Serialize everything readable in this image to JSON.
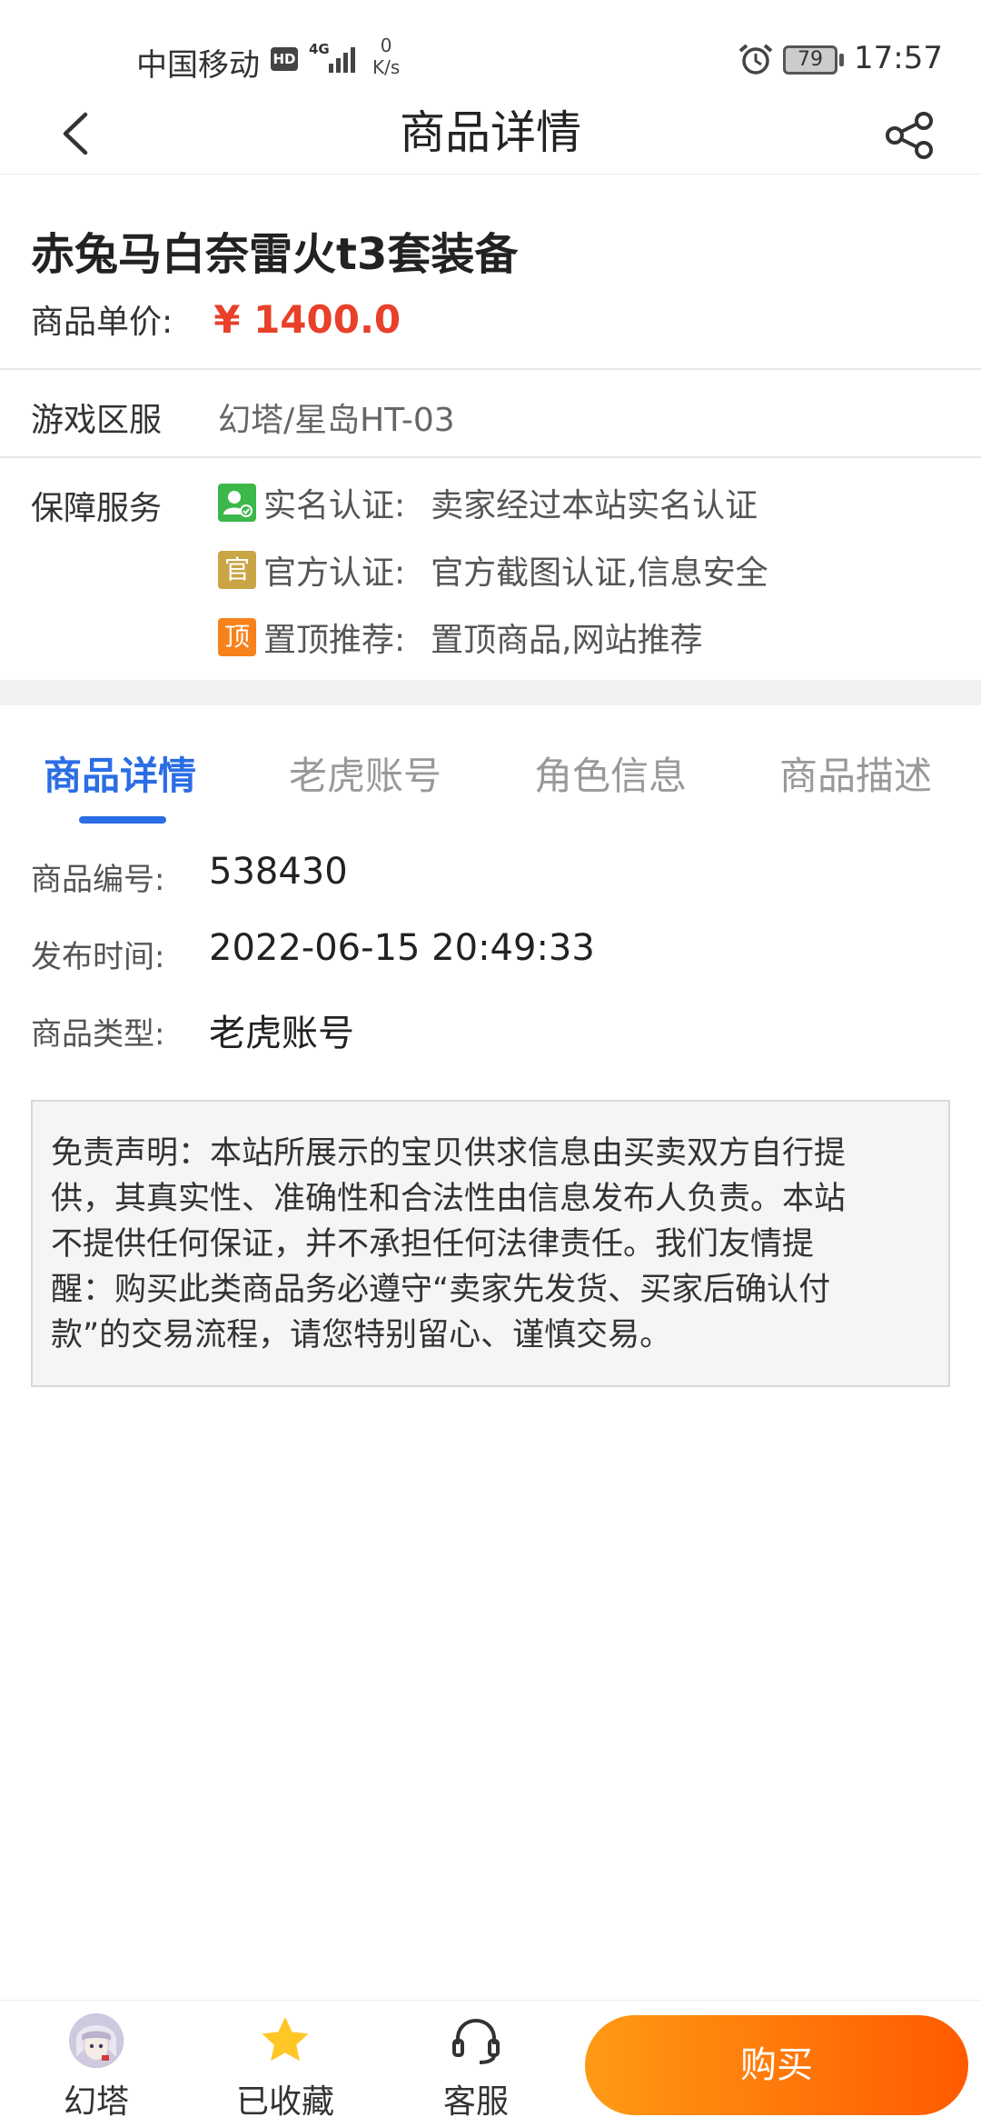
{
  "status_bar": {
    "carrier": "中国移动",
    "hd": "HD",
    "network": "4G",
    "speed_value": "0",
    "speed_unit": "K/s",
    "battery": "79",
    "time": "17:57"
  },
  "header": {
    "title": "商品详情",
    "back_icon": "chevron-left-icon",
    "share_icon": "share-icon"
  },
  "product": {
    "name": "赤兔马白奈雷火t3套装备",
    "price_label": "商品单价:",
    "price_value": "¥ 1400.0",
    "price_color": "#e8402a"
  },
  "server": {
    "label": "游戏区服",
    "value": "幻塔/星岛HT-03"
  },
  "guarantee": {
    "label": "保障服务",
    "services": [
      {
        "icon": "user-verify-icon",
        "icon_text": "",
        "color": "#3cb84a",
        "title": "实名认证:",
        "desc": "卖家经过本站实名认证"
      },
      {
        "icon": "official-badge-icon",
        "icon_text": "官",
        "color": "#c9a545",
        "title": "官方认证:",
        "desc": "官方截图认证,信息安全"
      },
      {
        "icon": "top-badge-icon",
        "icon_text": "顶",
        "color": "#f7821b",
        "title": "置顶推荐:",
        "desc": "置顶商品,网站推荐"
      }
    ]
  },
  "tabs": [
    {
      "label": "商品详情",
      "active": true
    },
    {
      "label": "老虎账号",
      "active": false
    },
    {
      "label": "角色信息",
      "active": false
    },
    {
      "label": "商品描述",
      "active": false
    }
  ],
  "details": [
    {
      "label": "商品编号:",
      "value": "538430"
    },
    {
      "label": "发布时间:",
      "value": "2022-06-15 20:49:33"
    },
    {
      "label": "商品类型:",
      "value": "老虎账号"
    }
  ],
  "disclaimer": {
    "lines": [
      "免责声明：本站所展示的宝贝供求信息由买卖双方自行提",
      "供，其真实性、准确性和合法性由信息发布人负责。本站",
      "不提供任何保证，并不承担任何法律责任。我们友情提",
      "醒：购买此类商品务必遵守“卖家先发货、买家后确认付",
      "款”的交易流程，请您特别留心、谨慎交易。"
    ]
  },
  "bottom_bar": {
    "items": [
      {
        "label": "幻塔",
        "icon": "game-avatar-icon"
      },
      {
        "label": "已收藏",
        "icon": "star-icon"
      },
      {
        "label": "客服",
        "icon": "headset-icon"
      }
    ],
    "buy_label": "购买"
  },
  "colors": {
    "accent": "#2b6de5",
    "buy_gradient_start": "#ff9a15",
    "buy_gradient_end": "#ff5a00",
    "star": "#ffc626"
  }
}
